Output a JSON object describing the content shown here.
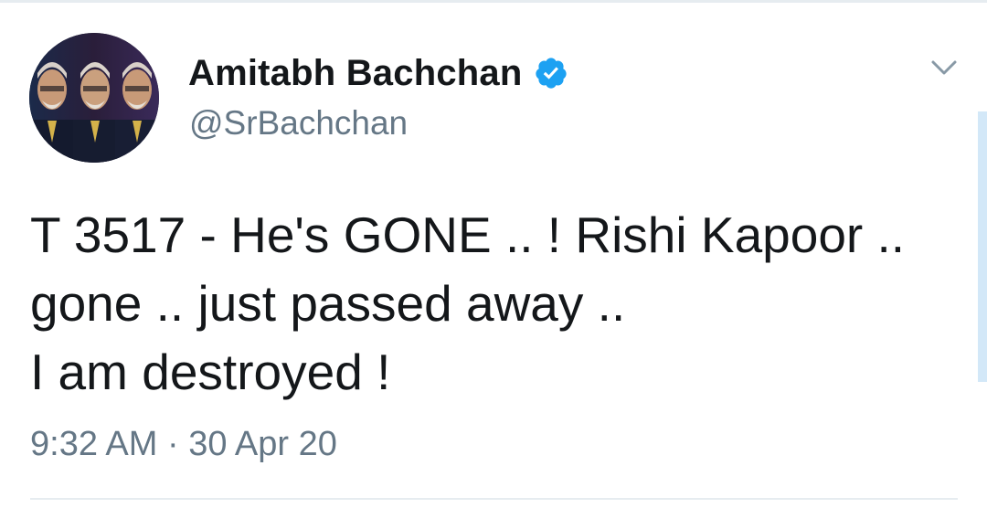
{
  "tweet": {
    "author": {
      "display_name": "Amitabh Bachchan",
      "handle": "@SrBachchan",
      "verified": true,
      "avatar_icon": "profile-photo"
    },
    "text_lines": [
      "T 3517 - He's GONE .. ! Rishi Kapoor ..",
      "gone .. just passed away ..",
      "I am destroyed !"
    ],
    "time": "9:32 AM",
    "separator": "·",
    "date": "30 Apr 20",
    "menu_icon": "chevron-down-icon"
  },
  "colors": {
    "text_primary": "#14171a",
    "text_secondary": "#657786",
    "verified_blue": "#1da1f2",
    "divider": "#e6ecf0"
  }
}
